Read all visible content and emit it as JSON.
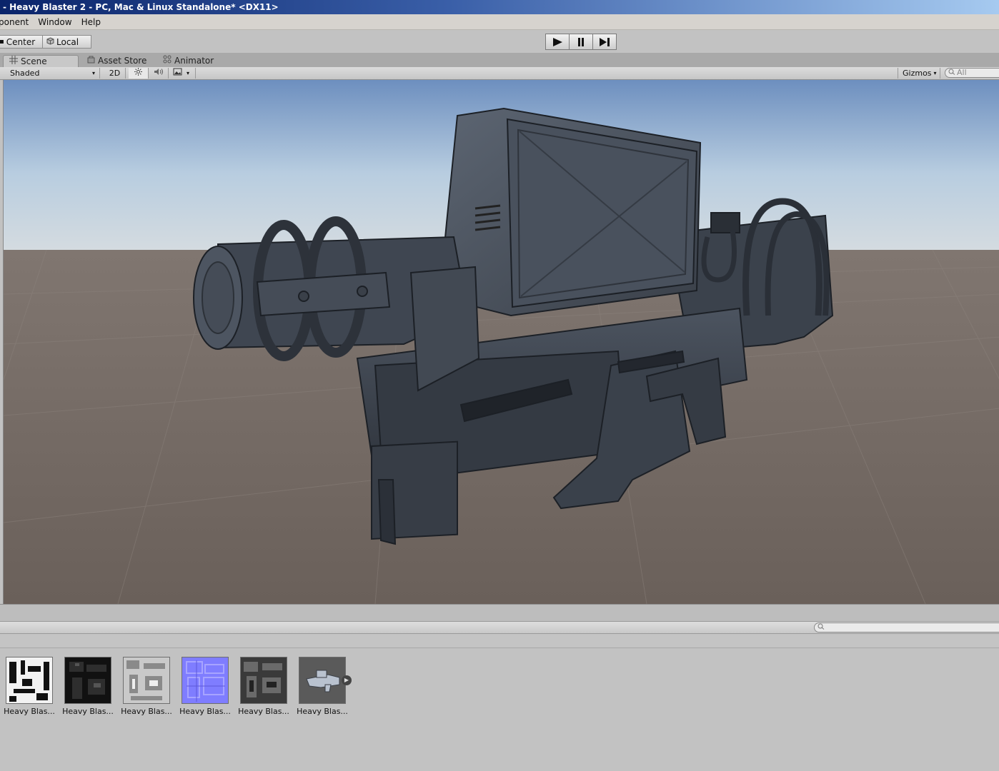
{
  "window": {
    "title": "- Heavy Blaster 2 - PC, Mac & Linux Standalone* <DX11>"
  },
  "menu": [
    "ponent",
    "Window",
    "Help"
  ],
  "toolbar": {
    "pivot_label": "Center",
    "space_label": "Local"
  },
  "tabs": [
    {
      "label": "Scene",
      "icon": "grid-icon",
      "active": true
    },
    {
      "label": "Asset Store",
      "icon": "store-icon",
      "active": false
    },
    {
      "label": "Animator",
      "icon": "animator-icon",
      "active": false
    }
  ],
  "scene_toolbar": {
    "draw_mode": "Shaded",
    "mode_2d": "2D",
    "gizmos_label": "Gizmos",
    "search_placeholder": "All"
  },
  "project": {
    "assets": [
      {
        "label": "Heavy Blas...",
        "kind": "albedo-texture"
      },
      {
        "label": "Heavy Blas...",
        "kind": "metallic-texture"
      },
      {
        "label": "Heavy Blas...",
        "kind": "ao-texture"
      },
      {
        "label": "Heavy Blas...",
        "kind": "normal-map"
      },
      {
        "label": "Heavy Blas...",
        "kind": "roughness-texture"
      },
      {
        "label": "Heavy Blas...",
        "kind": "model-prefab"
      }
    ]
  }
}
